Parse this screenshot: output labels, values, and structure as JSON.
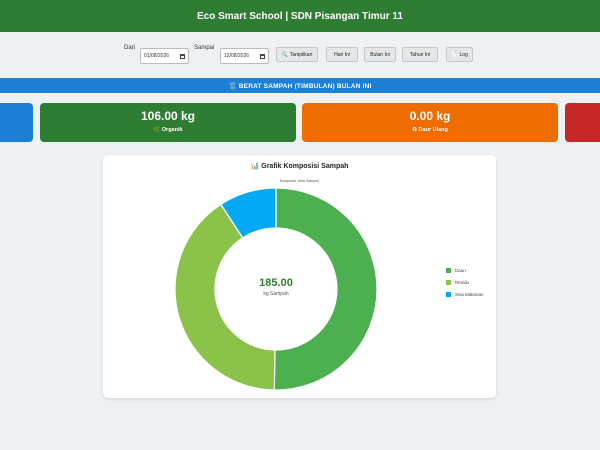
{
  "header": {
    "title": "Eco Smart School | SDN Pisangan Timur 11"
  },
  "filters": {
    "from_label": "Dari",
    "from_value": "01/08/2026",
    "to_label": "Sampai",
    "to_value": "12/08/2026",
    "buttons": {
      "show": "Tampilkan",
      "today": "Hari Ini",
      "month": "Bulan Ini",
      "year": "Tahun Ini",
      "log": "Log"
    }
  },
  "section": {
    "title": "🗑️ BERAT SAMPAH (TIMBULAN) BULAN INI"
  },
  "cards": {
    "organic": {
      "value": "106.00 kg",
      "label": "🌿 Organik",
      "color": "#2e7d32"
    },
    "recycle": {
      "value": "0.00 kg",
      "label": "♻ Daur Ulang",
      "color": "#ef6c00"
    },
    "left_partial_color": "#1e7fd6",
    "right_partial_color": "#c62828"
  },
  "chart_panel": {
    "title": "📊 Grafik Komposisi Sampah",
    "subtitle": "Komposisi Jenis Sampah",
    "center_value": "185.00",
    "center_unit": "kg Sampah"
  },
  "chart_data": {
    "type": "pie",
    "title": "Komposisi Jenis Sampah",
    "total_center_label": "185.00",
    "series": [
      {
        "name": "Daun",
        "value": 93,
        "color": "#4caf50"
      },
      {
        "name": "Residu",
        "value": 75,
        "color": "#8bc34a"
      },
      {
        "name": "Sisa Makanan",
        "value": 17,
        "color": "#03a9f4"
      }
    ],
    "legend_position": "right"
  }
}
